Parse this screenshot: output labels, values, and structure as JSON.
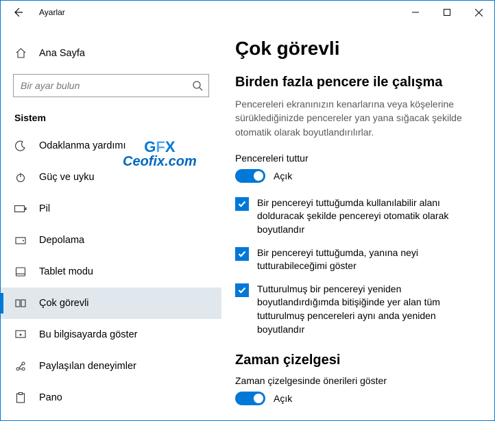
{
  "titlebar": {
    "app_title": "Ayarlar"
  },
  "sidebar": {
    "home_label": "Ana Sayfa",
    "search_placeholder": "Bir ayar bulun",
    "category_label": "Sistem",
    "items": [
      {
        "label": "Odaklanma yardımı",
        "icon": "moon-icon"
      },
      {
        "label": "Güç ve uyku",
        "icon": "power-icon"
      },
      {
        "label": "Pil",
        "icon": "battery-icon"
      },
      {
        "label": "Depolama",
        "icon": "storage-icon"
      },
      {
        "label": "Tablet modu",
        "icon": "tablet-icon"
      },
      {
        "label": "Çok görevli",
        "icon": "multitask-icon"
      },
      {
        "label": "Bu bilgisayarda göster",
        "icon": "project-icon"
      },
      {
        "label": "Paylaşılan deneyimler",
        "icon": "shared-icon"
      },
      {
        "label": "Pano",
        "icon": "clipboard-icon"
      }
    ],
    "selected_index": 5
  },
  "watermark": {
    "line1": "GFX",
    "line2": "Ceofix.com"
  },
  "content": {
    "h1": "Çok görevli",
    "section1_title": "Birden fazla pencere ile çalışma",
    "section1_desc": "Pencereleri ekranınızın kenarlarına veya köşelerine sürüklediğinizde pencereler yan yana sığacak şekilde otomatik olarak boyutlandırılırlar.",
    "snap_label": "Pencereleri tuttur",
    "snap_state_label": "Açık",
    "checks": [
      "Bir pencereyi tuttuğumda kullanılabilir alanı dolduracak şekilde pencereyi otomatik olarak boyutlandır",
      "Bir pencereyi tuttuğumda, yanına neyi tutturabileceğimi göster",
      "Tutturulmuş bir pencereyi yeniden boyutlandırdığımda bitişiğinde yer alan tüm tutturulmuş pencereleri aynı anda yeniden boyutlandır"
    ],
    "section2_title": "Zaman çizelgesi",
    "timeline_label": "Zaman çizelgesinde önerileri göster",
    "timeline_state_label": "Açık"
  }
}
